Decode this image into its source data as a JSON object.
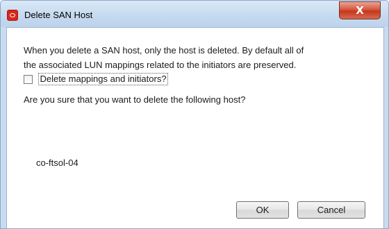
{
  "window": {
    "title": "Delete SAN Host",
    "title_icon": "oracle-logo-icon",
    "close_glyph": "X",
    "accent_color": "#c4381f"
  },
  "dialog": {
    "message_lines": [
      "When you delete a SAN host, only the host is deleted.  By default all of",
      "the associated LUN mappings related to the initiators are preserved."
    ],
    "checkbox": {
      "label": "Delete mappings and initiators?",
      "checked": false
    },
    "question": "Are you sure that you want to delete the following host?",
    "host_name": "co-ftsol-04"
  },
  "buttons": {
    "ok_label": "OK",
    "cancel_label": "Cancel"
  }
}
